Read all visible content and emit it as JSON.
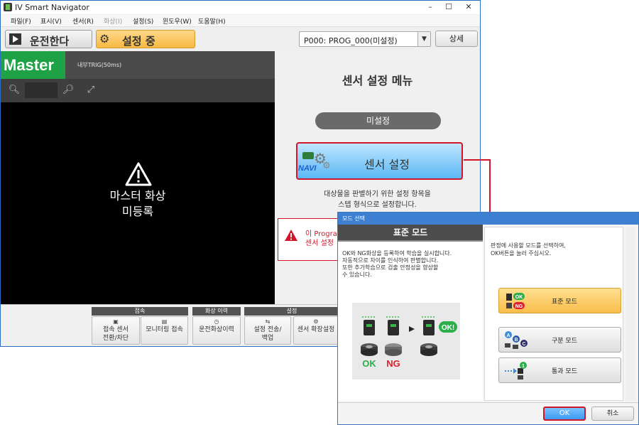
{
  "window": {
    "title": "IV Smart Navigator",
    "minimize": "–",
    "maximize": "☐",
    "close": "✕"
  },
  "menubar": {
    "items": [
      {
        "label": "파일(F)",
        "enabled": true
      },
      {
        "label": "표시(V)",
        "enabled": true
      },
      {
        "label": "센서(R)",
        "enabled": true
      },
      {
        "label": "화상(I)",
        "enabled": false
      },
      {
        "label": "설정(S)",
        "enabled": true
      },
      {
        "label": "윈도우(W)",
        "enabled": true
      },
      {
        "label": "도움말(H)",
        "enabled": true
      }
    ]
  },
  "toolbar": {
    "run_label": "운전한다",
    "setup_label": "설정 중",
    "program_value": "P000: PROG_000(미설정)",
    "detail_label": "상세"
  },
  "image_pane": {
    "master_label": "Master",
    "trigger_label": "내부TRIG(50ms)",
    "message_line1": "마스터 화상",
    "message_line2": "미등록"
  },
  "sensor_menu": {
    "title": "센서 설정 메뉴",
    "status": "미설정",
    "sensor_button": "센서 설정",
    "navi_text": "NAVI",
    "desc_line1": "대상물을 판별하기 위한 설정 항목을",
    "desc_line2": "스텝 형식으로 설정합니다.",
    "alert_line1": "이 Program",
    "alert_line2": "센서 설정"
  },
  "ribbon": {
    "groups": {
      "connect": "접속",
      "history": "화상 이력",
      "settings": "설정"
    },
    "buttons": {
      "connect_switch_1": "접속 센서",
      "connect_switch_2": "전환/차단",
      "monitor": "모니터링 접속",
      "run_history": "운전화상이력",
      "transfer_1": "설정 전송/",
      "transfer_2": "백업",
      "extension": "센서 확장설정"
    }
  },
  "dialog": {
    "title": "모드 선택",
    "left_header": "표준 모드",
    "left_desc": [
      "OK와 NG화상을 등록하여 학습을 실시합니다.",
      "자동적으로 차이를 인식하여 판별합니다.",
      "또한 추가학습으로 검출 안정성을 향상할",
      "수 있습니다."
    ],
    "illust_ok": "OK",
    "illust_ng": "NG",
    "illust_badge": "OK!",
    "right_desc_line1": "판정에 사용할 모드를 선택하여,",
    "right_desc_line2": "OK버튼을 눌러 주십시오.",
    "modes": [
      {
        "label": "표준 모드",
        "active": true
      },
      {
        "label": "구분 모드",
        "active": false
      },
      {
        "label": "통과 모드",
        "active": false
      }
    ],
    "ok_label": "OK",
    "cancel_label": "취소",
    "icon_ok": "OK",
    "icon_ng": "NG",
    "icon_a": "A",
    "icon_b": "B",
    "icon_c": "C",
    "icon_1": "1"
  },
  "colors": {
    "accent_red": "#d0162a",
    "master_green": "#1fa245",
    "setup_orange": "#f7b942",
    "sensor_blue": "#5bb8f4"
  }
}
